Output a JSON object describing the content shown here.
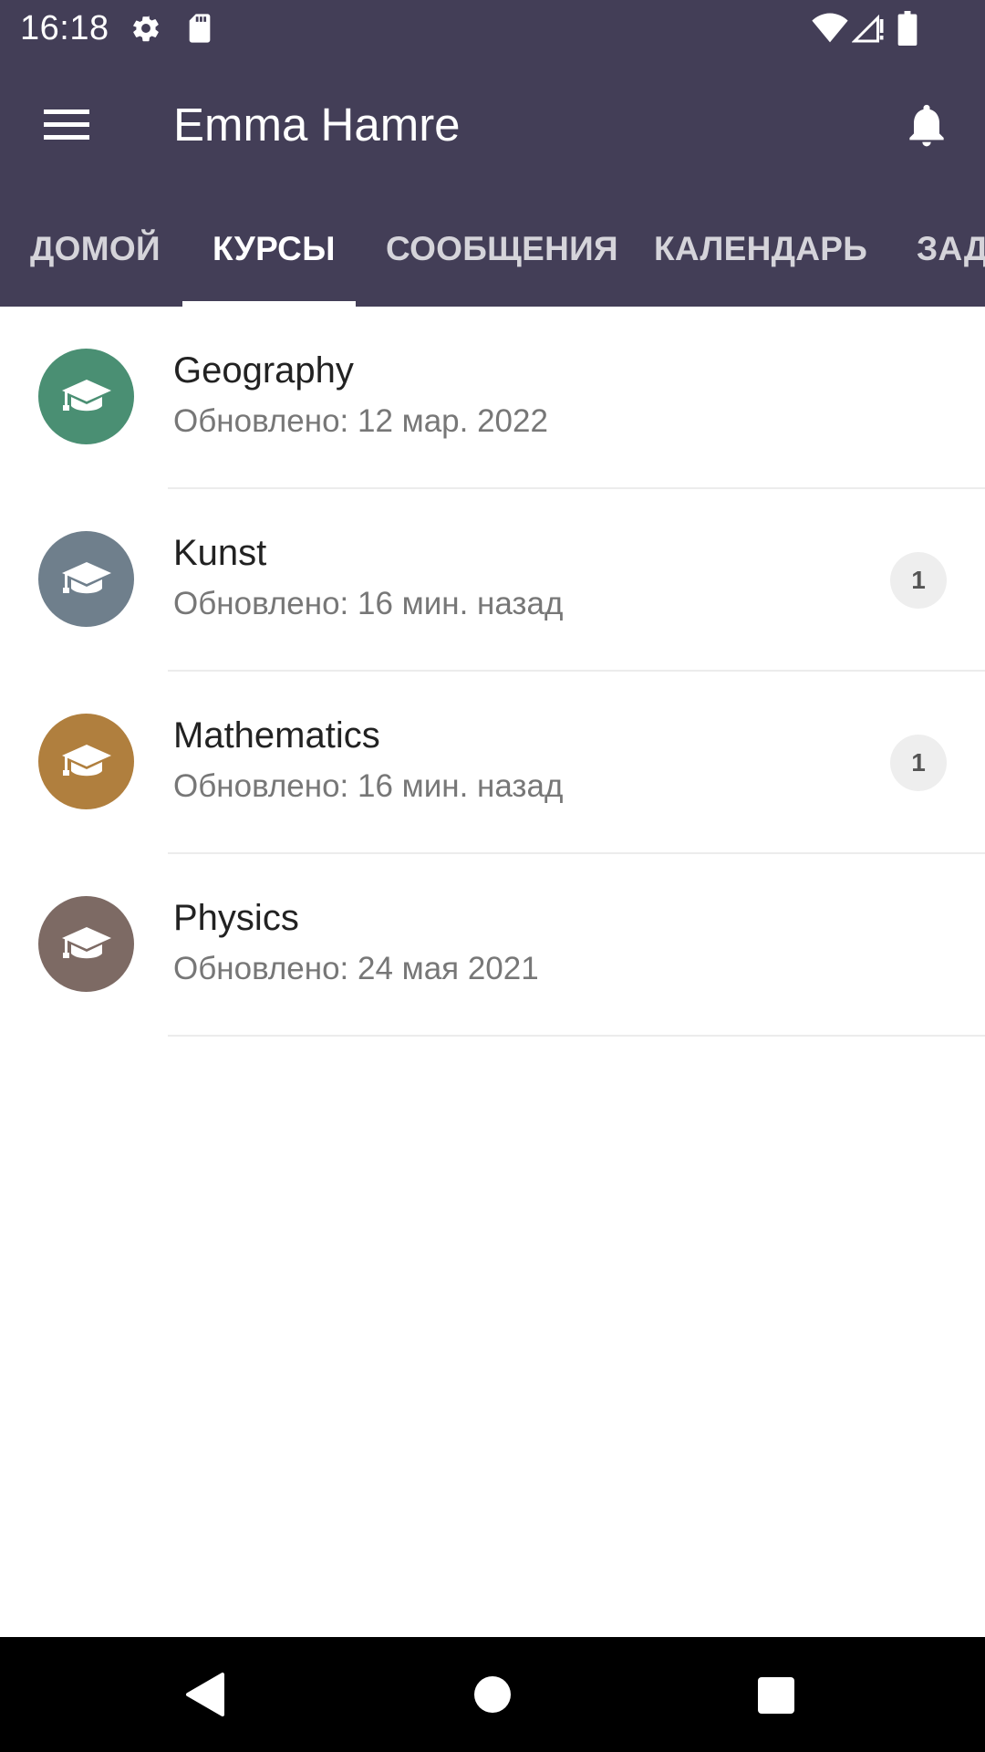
{
  "status_bar": {
    "time": "16:18",
    "icons": [
      "settings-icon",
      "sd-card-icon",
      "wifi-icon",
      "signal-icon",
      "battery-icon"
    ]
  },
  "app_bar": {
    "title": "Emma Hamre",
    "menu_icon": "menu-icon",
    "notification_icon": "bell-icon",
    "background_color": "#433e57"
  },
  "tabs": [
    {
      "label": "ДОМОЙ",
      "active": false
    },
    {
      "label": "КУРСЫ",
      "active": true
    },
    {
      "label": "СООБЩЕНИЯ",
      "active": false
    },
    {
      "label": "КАЛЕНДАРЬ",
      "active": false
    },
    {
      "label": "ЗАД",
      "active": false
    }
  ],
  "courses": [
    {
      "name": "Geography",
      "updated": "Обновлено: 12 мар. 2022",
      "color": "#4a8f73",
      "badge": null,
      "icon": "graduation-cap-icon"
    },
    {
      "name": "Kunst",
      "updated": "Обновлено: 16 мин. назад",
      "color": "#6f7f8c",
      "badge": "1",
      "icon": "graduation-cap-icon"
    },
    {
      "name": "Mathematics",
      "updated": "Обновлено: 16 мин. назад",
      "color": "#b07f3e",
      "badge": "1",
      "icon": "graduation-cap-icon"
    },
    {
      "name": "Physics",
      "updated": "Обновлено: 24 мая 2021",
      "color": "#7d6a64",
      "badge": null,
      "icon": "graduation-cap-icon"
    }
  ],
  "nav_bar": {
    "buttons": [
      "back-icon",
      "home-icon",
      "recents-icon"
    ]
  }
}
